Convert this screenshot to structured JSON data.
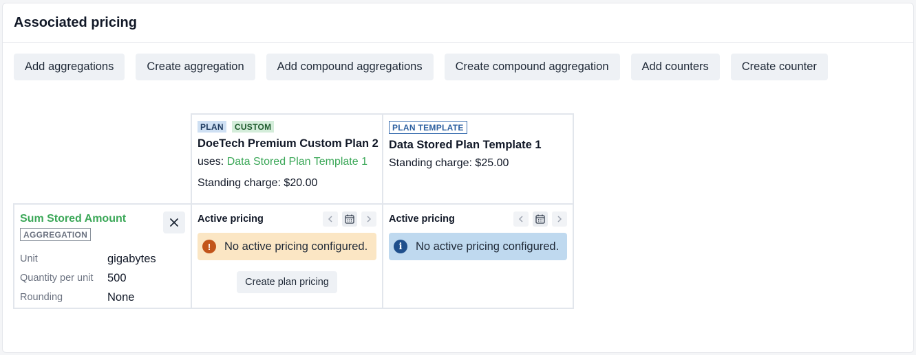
{
  "section": {
    "title": "Associated pricing"
  },
  "toolbar": {
    "buttons": [
      "Add aggregations",
      "Create aggregation",
      "Add compound aggregations",
      "Create compound aggregation",
      "Add counters",
      "Create counter"
    ]
  },
  "plans": [
    {
      "badges": [
        "PLAN",
        "CUSTOM"
      ],
      "name": "DoeTech Premium Custom Plan 2",
      "uses_prefix": "uses:",
      "uses_link": "Data Stored Plan Template 1",
      "standing_charge": "Standing charge: $20.00"
    },
    {
      "badges": [
        "PLAN TEMPLATE"
      ],
      "name": "Data Stored Plan Template 1",
      "standing_charge": "Standing charge: $25.00"
    }
  ],
  "aggregation": {
    "name": "Sum Stored Amount",
    "badge": "AGGREGATION",
    "fields": [
      {
        "key": "Unit",
        "value": "gigabytes"
      },
      {
        "key": "Quantity per unit",
        "value": "500"
      },
      {
        "key": "Rounding",
        "value": "None"
      }
    ]
  },
  "pricing": [
    {
      "title": "Active pricing",
      "alert": "No active pricing configured.",
      "alert_type": "warning",
      "action": "Create plan pricing"
    },
    {
      "title": "Active pricing",
      "alert": "No active pricing configured.",
      "alert_type": "info"
    }
  ],
  "colors": {
    "link_green": "#3aa757",
    "warning_bg": "#fbe6c4",
    "info_bg": "#bfd9ef"
  }
}
